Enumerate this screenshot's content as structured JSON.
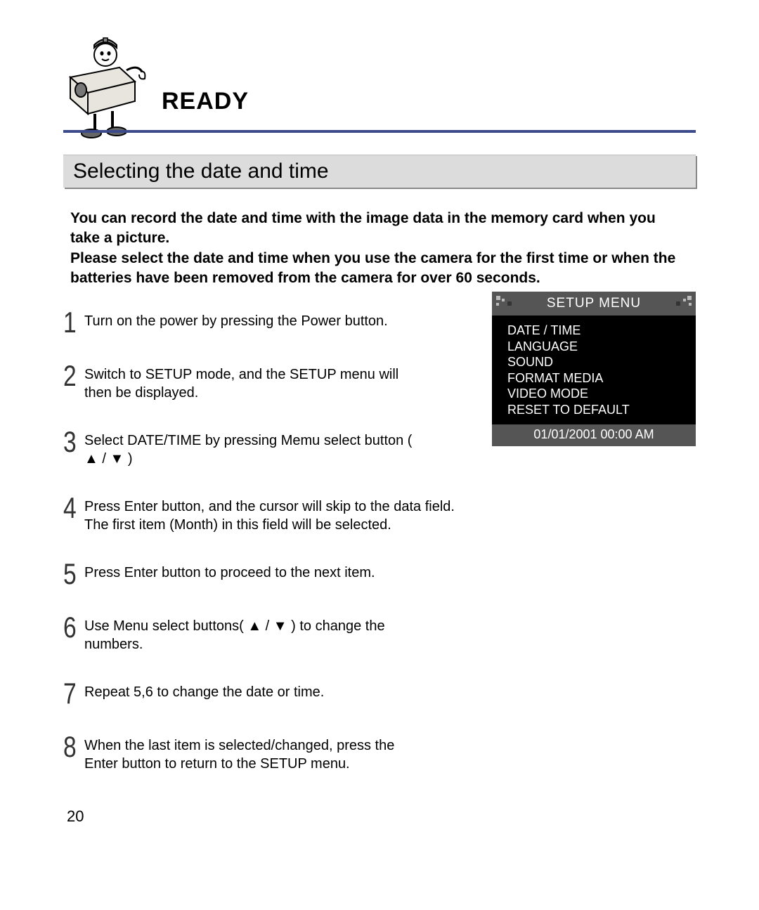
{
  "header": {
    "ready": "READY"
  },
  "section_title": "Selecting the date and time",
  "intro": "You can record the date and time with the image data in the memory card when you take a picture.\nPlease select the date and time when you use the camera for the first time or when the batteries have been removed from the camera for over 60 seconds.",
  "steps": [
    "Turn on the power by pressing the Power button.",
    "Switch to SETUP mode, and the SETUP menu will then be displayed.",
    "Select DATE/TIME by pressing Memu select button ( ▲ / ▼ )",
    "Press Enter button, and the cursor will skip to the data field. The first item (Month) in this field will be selected.",
    "Press Enter button to proceed to the next item.",
    "Use Menu select buttons( ▲ / ▼ ) to change the numbers.",
    "Repeat 5,6 to change the date or time.",
    "When the last item is selected/changed, press the Enter button to return to the SETUP menu."
  ],
  "step_numbers": [
    "1",
    "2",
    "3",
    "4",
    "5",
    "6",
    "7",
    "8"
  ],
  "setup_menu": {
    "title": "SETUP MENU",
    "items": [
      "DATE / TIME",
      "LANGUAGE",
      "SOUND",
      "FORMAT MEDIA",
      "VIDEO MODE",
      "RESET TO DEFAULT"
    ],
    "footer": "01/01/2001  00:00 AM"
  },
  "page_number": "20"
}
